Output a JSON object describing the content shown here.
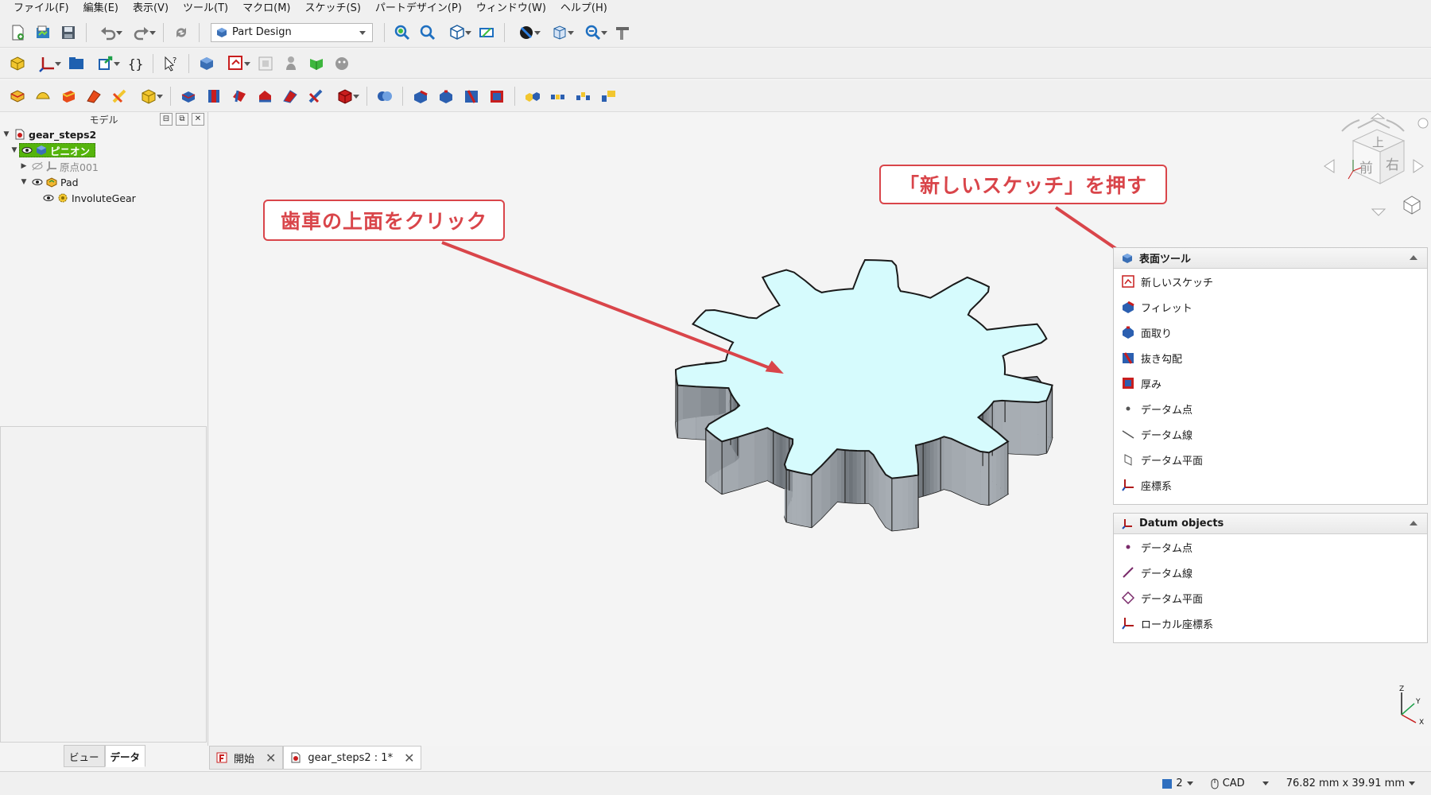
{
  "menu": [
    "ファイル(F)",
    "編集(E)",
    "表示(V)",
    "ツール(T)",
    "マクロ(M)",
    "スケッチ(S)",
    "パートデザイン(P)",
    "ウィンドウ(W)",
    "ヘルプ(H)"
  ],
  "toolbar": {
    "workbench": "Part Design"
  },
  "model_panel": {
    "title": "モデル",
    "tree": {
      "document": "gear_steps2",
      "body": "ピニオン",
      "origin": "原点001",
      "pad": "Pad",
      "gear": "InvoluteGear"
    }
  },
  "left_tabs": [
    "ビュー",
    "データ"
  ],
  "annotations": {
    "click_face": "歯車の上面をクリック",
    "press_sketch": "「新しいスケッチ」を押す"
  },
  "navcube": {
    "top": "上",
    "front": "前",
    "right": "右"
  },
  "task_panel": {
    "surface_tools": {
      "title": "表面ツール",
      "items": [
        "新しいスケッチ",
        "フィレット",
        "面取り",
        "抜き勾配",
        "厚み",
        "データム点",
        "データム線",
        "データム平面",
        "座標系"
      ]
    },
    "datum_objects": {
      "title": "Datum objects",
      "items": [
        "データム点",
        "データム線",
        "データム平面",
        "ローカル座標系"
      ]
    }
  },
  "axis": {
    "z": "Z",
    "y": "Y",
    "x": "X"
  },
  "doc_tabs": [
    "開始",
    "gear_steps2 : 1*"
  ],
  "status": {
    "layers": "2",
    "nav_style": "CAD",
    "dimensions": "76.82 mm x 39.91 mm"
  },
  "colors": {
    "gear_top": "#d6fbfd",
    "gear_side": "#8d9399",
    "annotation": "#d9454a",
    "selection": "#55b40c"
  }
}
